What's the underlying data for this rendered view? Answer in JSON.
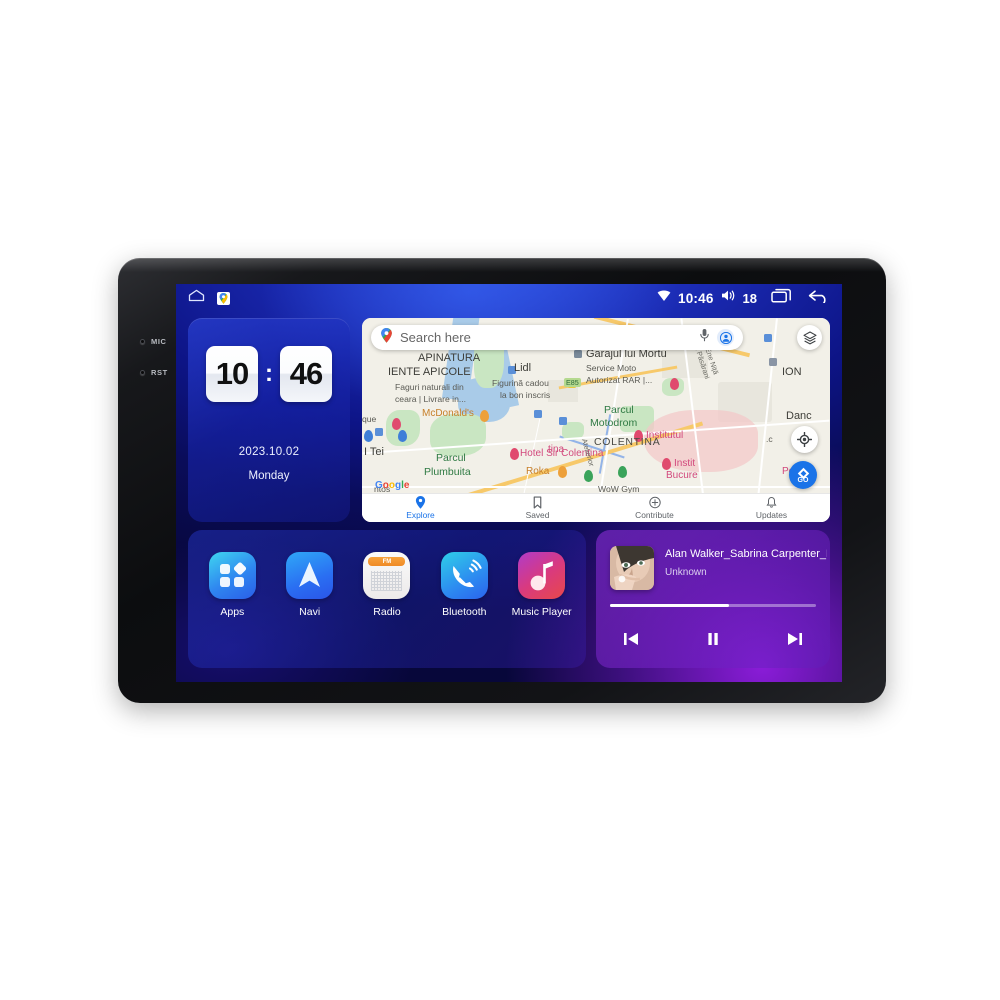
{
  "device": {
    "bezel_labels": [
      "MIC",
      "RST"
    ]
  },
  "statusbar": {
    "home_icon": "home-icon",
    "maps_icon": "google-maps-icon",
    "wifi_icon": "wifi-icon",
    "time": "10:46",
    "volume_icon": "volume-icon",
    "volume_level": "18",
    "recents_icon": "recents-icon",
    "back_icon": "back-icon"
  },
  "clock_widget": {
    "hours": "10",
    "colon": ":",
    "minutes": "46",
    "date": "2023.10.02",
    "weekday": "Monday"
  },
  "map": {
    "search_placeholder": "Search here",
    "mic_icon": "microphone-icon",
    "account_icon": "account-avatar-icon",
    "layers_icon": "map-layers-icon",
    "locate_icon": "my-location-icon",
    "go_label": "GO",
    "watermark": "Google",
    "labels": {
      "apinatura": "APINATURA",
      "ente_apicole": "IENTE APICOLE",
      "apicole_desc1": "Faguri naturali din",
      "apicole_desc2": "ceara | Livrare in...",
      "lidl": "Lidl",
      "lidl_desc1": "Figurină cadou",
      "lidl_desc2": "la bon inscris",
      "garajul": "Garajul lui Mortu",
      "garajul_desc1": "Service Moto",
      "garajul_desc2": "Autorizat RAR |...",
      "ion": "ION",
      "street_ene": "Ja Ene Niță",
      "street_pasarani": "ada Păsărani",
      "que": "que",
      "mcdonalds": "McDonald's",
      "parcul_motodrom1": "Parcul",
      "parcul_motodrom2": "Motodrom",
      "danc": "Danc",
      "institutul": "Institutul",
      "colentina": "COLENTINA",
      "tina": "tina",
      "i_tei": "I Tei",
      "parcul_plumbuita1": "Parcul",
      "parcul_plumbuita2": "Plumbuita",
      "hotel": "Hotel Sir Colentina",
      "roka": "Roka",
      "instit1": "Instit",
      "instit2": "Bucure",
      "e85": "E85",
      "atelierlor": "Atelierlor",
      "wow_gym": "WoW Gym",
      "ntos": "ntos",
      "pc": ".c",
      "pe": "Pe"
    },
    "tabs": [
      {
        "label": "Explore",
        "icon": "explore-pin-icon",
        "active": true
      },
      {
        "label": "Saved",
        "icon": "bookmark-icon",
        "active": false
      },
      {
        "label": "Contribute",
        "icon": "contribute-plus-icon",
        "active": false
      },
      {
        "label": "Updates",
        "icon": "bell-icon",
        "active": false
      }
    ]
  },
  "dock": {
    "apps": [
      {
        "label": "Apps",
        "icon": "apps-grid-icon"
      },
      {
        "label": "Navi",
        "icon": "navigation-arrow-icon"
      },
      {
        "label": "Radio",
        "icon": "radio-icon",
        "band": "FM"
      },
      {
        "label": "Bluetooth",
        "icon": "bluetooth-phone-icon"
      },
      {
        "label": "Music Player",
        "icon": "music-note-icon"
      }
    ]
  },
  "music": {
    "album_art": "album-art-portrait",
    "title": "Alan Walker_Sabrina Carpenter_F...",
    "artist": "Unknown",
    "progress_percent": 58,
    "previous_icon": "skip-previous-icon",
    "pause_icon": "pause-icon",
    "next_icon": "skip-next-icon"
  },
  "colors": {
    "accent_blue": "#1a73e8",
    "screen_blue": "#141cb4",
    "screen_purple": "#6d17b5",
    "music_purple": "#8c2dd7"
  }
}
